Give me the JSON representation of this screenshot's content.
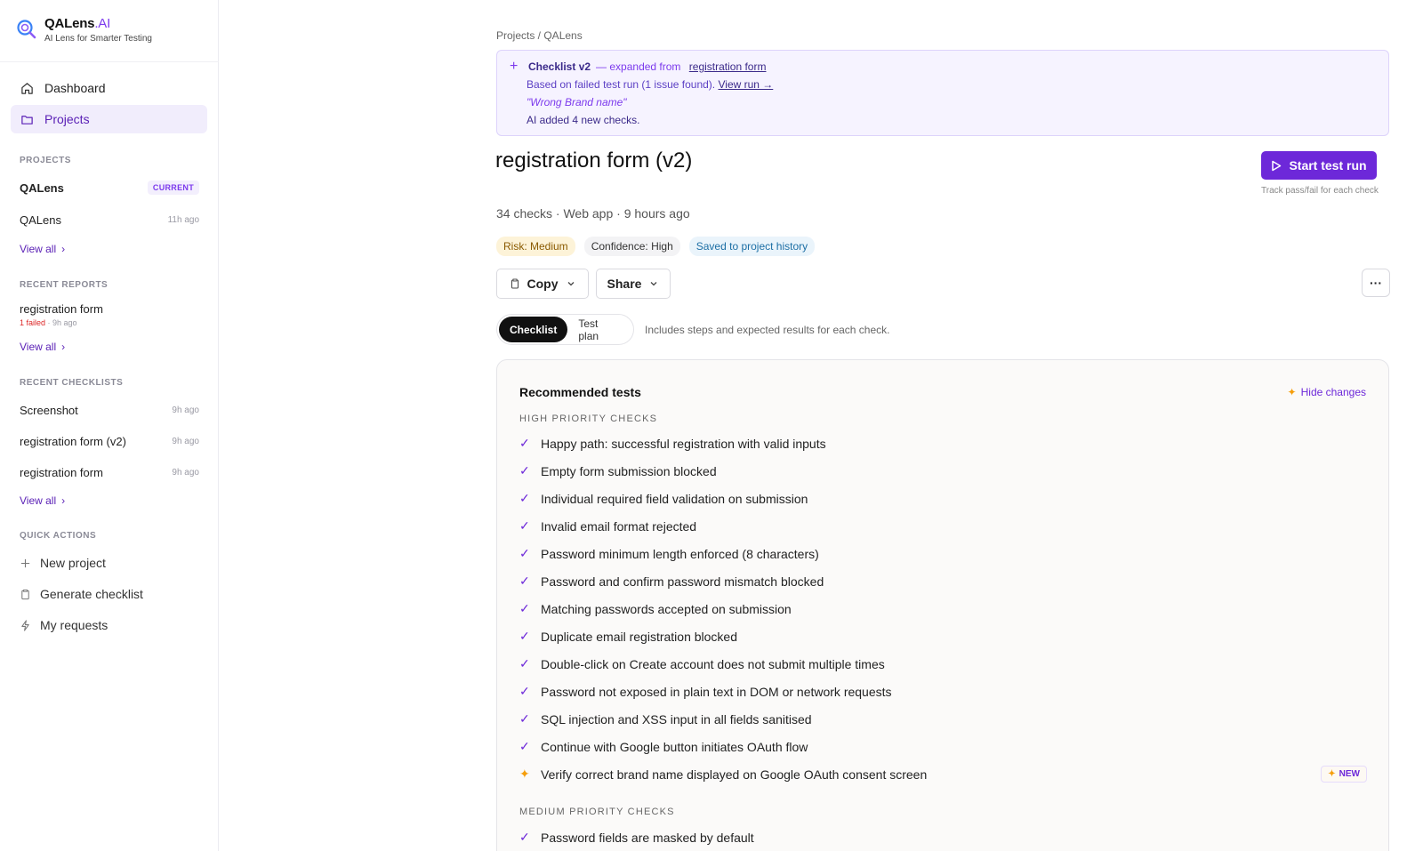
{
  "brand": {
    "name": "QALens",
    "name_suffix": ".AI",
    "tagline": "AI Lens for Smarter Testing"
  },
  "nav": {
    "dashboard": "Dashboard",
    "projects": "Projects"
  },
  "sidebar": {
    "projects_label": "PROJECTS",
    "projects": [
      {
        "name": "QALens",
        "badge": "CURRENT"
      },
      {
        "name": "QALens",
        "meta": "11h ago"
      }
    ],
    "view_all": "View all",
    "reports_label": "RECENT REPORTS",
    "report": {
      "name": "registration form",
      "failed": "1 failed",
      "meta": " · 9h ago"
    },
    "checklists_label": "RECENT CHECKLISTS",
    "checklists": [
      {
        "name": "Screenshot",
        "meta": "9h ago"
      },
      {
        "name": "registration form (v2)",
        "meta": "9h ago"
      },
      {
        "name": "registration form",
        "meta": "9h ago"
      }
    ],
    "quick_label": "QUICK ACTIONS",
    "quick": [
      "New project",
      "Generate checklist",
      "My requests"
    ]
  },
  "breadcrumb": "Projects / QALens",
  "banner": {
    "title": "Checklist v2",
    "expanded": "— expanded from",
    "source_link": "registration form",
    "based_on": "Based on failed test run (1 issue found).",
    "view_run": "View run →",
    "quote": "\"Wrong Brand name\"",
    "added": "AI added 4 new checks."
  },
  "page": {
    "title": "registration form (v2)",
    "meta": "34 checks · Web app · 9 hours ago",
    "start_button": "Start test run",
    "start_hint": "Track pass/fail for each check",
    "chips": {
      "risk": "Risk: Medium",
      "confidence": "Confidence: High",
      "saved": "Saved to project history"
    },
    "copy": "Copy",
    "share": "Share",
    "more": "···",
    "tabs": {
      "checklist": "Checklist",
      "test_plan": "Test plan"
    },
    "tabs_hint": "Includes steps and expected results for each check."
  },
  "card": {
    "title": "Recommended tests",
    "hide_changes": "Hide changes",
    "high_label": "HIGH PRIORITY CHECKS",
    "high": [
      "Happy path: successful registration with valid inputs",
      "Empty form submission blocked",
      "Individual required field validation on submission",
      "Invalid email format rejected",
      "Password minimum length enforced (8 characters)",
      "Password and confirm password mismatch blocked",
      "Matching passwords accepted on submission",
      "Duplicate email registration blocked",
      "Double-click on Create account does not submit multiple times",
      "Password not exposed in plain text in DOM or network requests",
      "SQL injection and XSS input in all fields sanitised",
      "Continue with Google button initiates OAuth flow",
      "Verify correct brand name displayed on Google OAuth consent screen"
    ],
    "new_badge": "NEW",
    "medium_label": "MEDIUM PRIORITY CHECKS",
    "medium": [
      "Password fields are masked by default"
    ]
  },
  "colors": {
    "accent": "#6d28d9",
    "active_bg": "#f1edfc",
    "banner_bg": "#f6f3ff"
  }
}
